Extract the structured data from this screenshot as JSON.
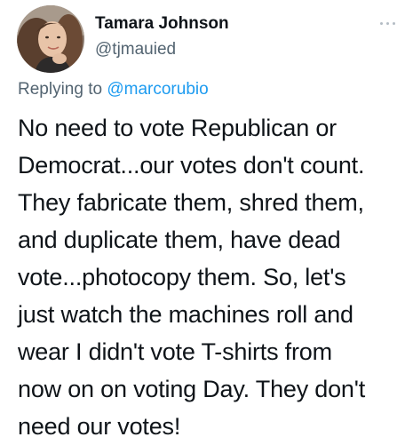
{
  "author": {
    "display_name": "Tamara Johnson",
    "handle": "@tjmauied",
    "avatar_icon": "profile-photo"
  },
  "reply_context": {
    "prefix": "Replying to",
    "mention": "@marcorubio"
  },
  "tweet": {
    "lines": [
      "No need to vote Republican or",
      "Democrat...our votes don't count.",
      "They fabricate them, shred them,",
      "and duplicate them, have dead",
      "vote...photocopy them. So, let's",
      "just watch the machines roll and",
      "wear I didn't vote T-shirts from",
      "now on on voting Day. They don't",
      "need our votes!"
    ]
  },
  "more_menu": {
    "icon": "more-horizontal-icon"
  },
  "colors": {
    "text": "#0f1419",
    "secondary": "#536471",
    "link": "#1d9bf0",
    "background": "#ffffff"
  }
}
